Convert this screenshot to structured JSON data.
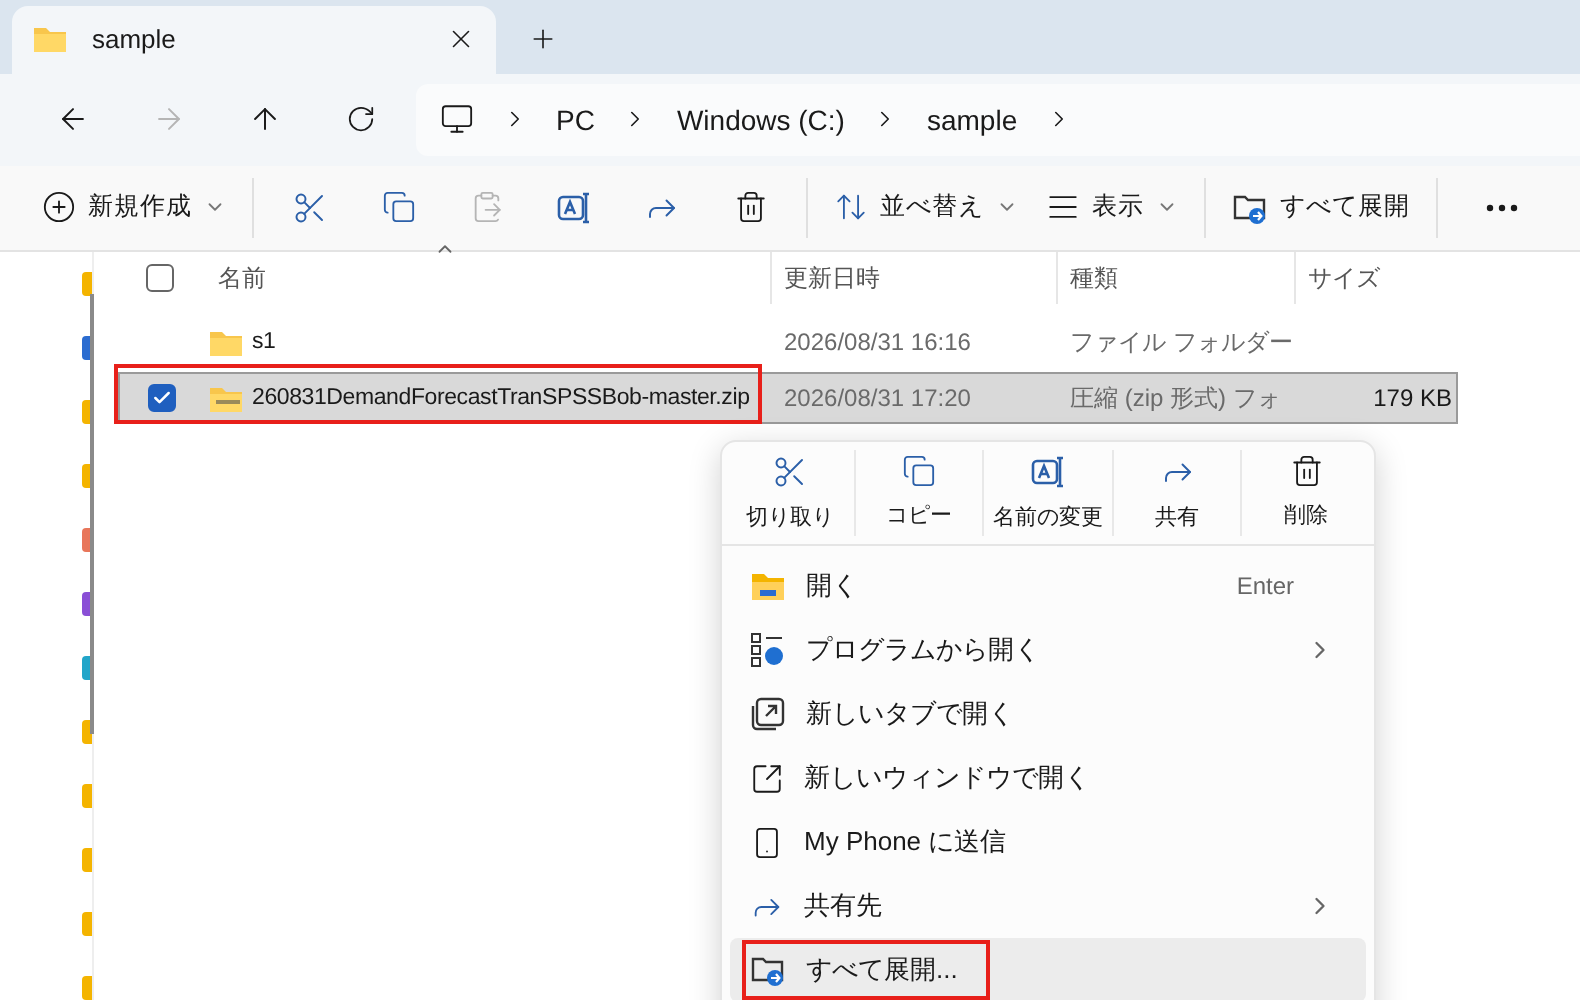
{
  "tab": {
    "title": "sample",
    "selected": true
  },
  "breadcrumb": [
    "PC",
    "Windows (C:)",
    "sample"
  ],
  "toolbar": [
    {
      "kind": "new",
      "label": "新規作成",
      "disabled": false
    },
    {
      "kind": "cut",
      "disabled": false
    },
    {
      "kind": "copy",
      "disabled": false
    },
    {
      "kind": "paste",
      "disabled": true
    },
    {
      "kind": "rename",
      "disabled": false
    },
    {
      "kind": "share",
      "disabled": false
    },
    {
      "kind": "delete",
      "disabled": false
    },
    {
      "kind": "sort",
      "label": "並べ替え",
      "disabled": false
    },
    {
      "kind": "view",
      "label": "表示",
      "disabled": false
    },
    {
      "kind": "extract",
      "label": "すべて展開",
      "disabled": false
    },
    {
      "kind": "more",
      "disabled": false
    }
  ],
  "table": {
    "select_all": {
      "checked": false
    },
    "columns": [
      "名前",
      "更新日時",
      "種類",
      "サイズ"
    ],
    "rows": [
      {
        "kind": "folder",
        "name": "s1",
        "modified": "2026/08/31 16:16",
        "type": "ファイル フォルダー",
        "size": "",
        "selected": false,
        "outlined": false
      },
      {
        "kind": "zip",
        "name": "260831DemandForecastTranSPSSBob-master.zip",
        "modified": "2026/08/31 17:20",
        "type": "圧縮 (zip 形式) フォ",
        "size": "179 KB",
        "selected": true,
        "outlined": true
      }
    ]
  },
  "context_menu": {
    "actions": [
      {
        "kind": "cut",
        "label": "切り取り"
      },
      {
        "kind": "copy",
        "label": "コピー"
      },
      {
        "kind": "rename",
        "label": "名前の変更"
      },
      {
        "kind": "share",
        "label": "共有"
      },
      {
        "kind": "delete",
        "label": "削除"
      }
    ],
    "items": [
      {
        "kind": "open",
        "label": "開く",
        "shortcut": "Enter",
        "submenu": false,
        "highlighted": false,
        "outlined": false
      },
      {
        "kind": "open-with",
        "label": "プログラムから開く",
        "submenu": true,
        "highlighted": false,
        "outlined": false
      },
      {
        "kind": "new-tab",
        "label": "新しいタブで開く",
        "submenu": false,
        "highlighted": false,
        "outlined": false
      },
      {
        "kind": "new-window",
        "label": "新しいウィンドウで開く",
        "submenu": false,
        "highlighted": false,
        "outlined": false
      },
      {
        "kind": "phone",
        "label": "My Phone に送信",
        "submenu": false,
        "highlighted": false,
        "outlined": false
      },
      {
        "kind": "share",
        "label": "共有先",
        "submenu": true,
        "highlighted": false,
        "outlined": false
      },
      {
        "kind": "extract",
        "label": "すべて展開...",
        "submenu": false,
        "highlighted": true,
        "outlined": true
      }
    ]
  }
}
